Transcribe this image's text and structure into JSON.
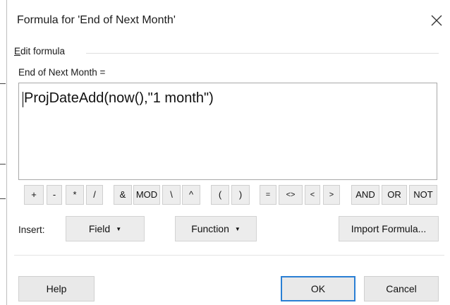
{
  "dialog": {
    "title": "Formula for 'End of Next Month'",
    "close_icon": "close-icon"
  },
  "group": {
    "label_mnemonic": "E",
    "label_rest": "dit formula"
  },
  "field_label": "End of Next Month =",
  "formula": {
    "value": "ProjDateAdd(now(),\"1 month\")"
  },
  "operators": [
    "+",
    "-",
    "*",
    "/",
    "&",
    "MOD",
    "\\",
    "^",
    "(",
    ")",
    "=",
    "<>",
    "<",
    ">",
    "AND",
    "OR",
    "NOT"
  ],
  "insert": {
    "label": "Insert:",
    "field_button": "Field",
    "function_button": "Function",
    "import_button": "Import Formula...",
    "dropdown_icon": "triangle-down-icon"
  },
  "footer": {
    "help": "Help",
    "ok": "OK",
    "cancel": "Cancel"
  }
}
